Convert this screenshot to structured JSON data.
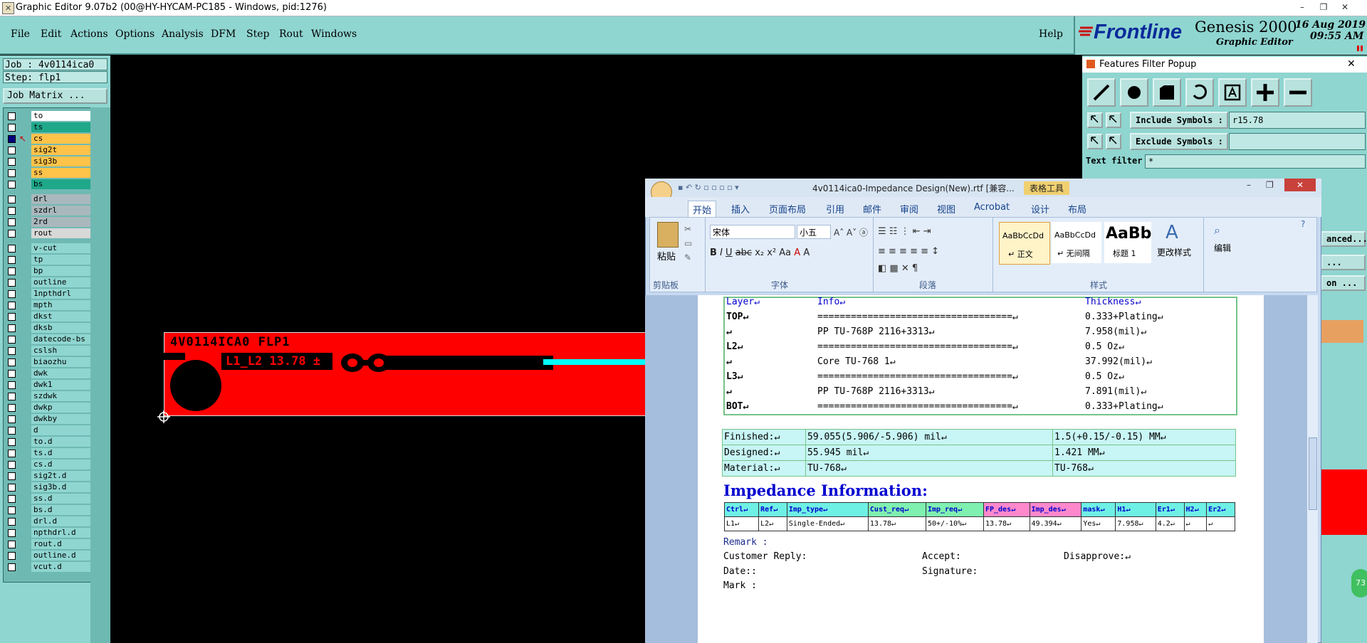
{
  "window": {
    "title": "Graphic Editor 9.07b2 (00@HY-HYCAM-PC185 - Windows, pid:1276)",
    "min": "–",
    "max": "❐",
    "close": "✕"
  },
  "menu": {
    "items": [
      "File",
      "Edit",
      "Actions",
      "Options",
      "Analysis",
      "DFM",
      "Step",
      "Rout",
      "Windows"
    ],
    "help": "Help"
  },
  "brand": {
    "logo": "Frontline",
    "product": "Genesis 2000",
    "subtitle": "Graphic Editor",
    "date": "16 Aug 2019",
    "time": "09:55 AM"
  },
  "left": {
    "job": "Job : 4v0114ica0",
    "step": "Step: flp1",
    "job_matrix": "Job Matrix ...",
    "layers": [
      {
        "name": "to",
        "color": "#ffffff",
        "on": false
      },
      {
        "name": "ts",
        "color": "#1fa88a",
        "on": false
      },
      {
        "name": "cs",
        "color": "#ffc34a",
        "on": true
      },
      {
        "name": "sig2t",
        "color": "#ffc34a",
        "on": false
      },
      {
        "name": "sig3b",
        "color": "#ffc34a",
        "on": false
      },
      {
        "name": "ss",
        "color": "#ffc34a",
        "on": false
      },
      {
        "name": "bs",
        "color": "#1fa88a",
        "on": false
      },
      {
        "name": "drl",
        "color": "#a9b8bd",
        "on": false
      },
      {
        "name": "szdrl",
        "color": "#a9b8bd",
        "on": false
      },
      {
        "name": "2rd",
        "color": "#a9b8bd",
        "on": false
      },
      {
        "name": "rout",
        "color": "#d8d8d8",
        "on": false
      },
      {
        "name": "v-cut",
        "color": "#8fd5d0",
        "on": false
      },
      {
        "name": "tp",
        "color": "#8fd5d0",
        "on": false
      },
      {
        "name": "bp",
        "color": "#8fd5d0",
        "on": false
      },
      {
        "name": "outline",
        "color": "#8fd5d0",
        "on": false
      },
      {
        "name": "1npthdrl",
        "color": "#8fd5d0",
        "on": false
      },
      {
        "name": "mpth",
        "color": "#8fd5d0",
        "on": false
      },
      {
        "name": "dkst",
        "color": "#8fd5d0",
        "on": false
      },
      {
        "name": "dksb",
        "color": "#8fd5d0",
        "on": false
      },
      {
        "name": "datecode-bs",
        "color": "#8fd5d0",
        "on": false
      },
      {
        "name": "cslsh",
        "color": "#8fd5d0",
        "on": false
      },
      {
        "name": "biaozhu",
        "color": "#8fd5d0",
        "on": false
      },
      {
        "name": "dwk",
        "color": "#8fd5d0",
        "on": false
      },
      {
        "name": "dwk1",
        "color": "#8fd5d0",
        "on": false
      },
      {
        "name": "szdwk",
        "color": "#8fd5d0",
        "on": false
      },
      {
        "name": "dwkp",
        "color": "#8fd5d0",
        "on": false
      },
      {
        "name": "dwkby",
        "color": "#8fd5d0",
        "on": false
      },
      {
        "name": "d",
        "color": "#8fd5d0",
        "on": false
      },
      {
        "name": "to.d",
        "color": "#8fd5d0",
        "on": false
      },
      {
        "name": "ts.d",
        "color": "#8fd5d0",
        "on": false
      },
      {
        "name": "cs.d",
        "color": "#8fd5d0",
        "on": false
      },
      {
        "name": "sig2t.d",
        "color": "#8fd5d0",
        "on": false
      },
      {
        "name": "sig3b.d",
        "color": "#8fd5d0",
        "on": false
      },
      {
        "name": "ss.d",
        "color": "#8fd5d0",
        "on": false
      },
      {
        "name": "bs.d",
        "color": "#8fd5d0",
        "on": false
      },
      {
        "name": "drl.d",
        "color": "#8fd5d0",
        "on": false
      },
      {
        "name": "npthdrl.d",
        "color": "#8fd5d0",
        "on": false
      },
      {
        "name": "rout.d",
        "color": "#8fd5d0",
        "on": false
      },
      {
        "name": "outline.d",
        "color": "#8fd5d0",
        "on": false
      },
      {
        "name": "vcut.d",
        "color": "#8fd5d0",
        "on": false
      }
    ]
  },
  "canvas": {
    "pcb_text1": "4V0114ICA0 FLP1",
    "pcb_text2": "L1_L2 13.78 ±"
  },
  "filter": {
    "title": "Features Filter Popup",
    "close": "✕",
    "include_label": "Include Symbols :",
    "include_value": "r15.78",
    "exclude_label": "Exclude Symbols :",
    "exclude_value": "",
    "text_filter_label": "Text filter",
    "text_filter_value": "*",
    "advanced": "anced...",
    "dots1": "...",
    "dots2": "on ..."
  },
  "word": {
    "title": "4v0114ica0-Impedance Design(New).rtf [兼容...",
    "context": "表格工具",
    "tabs": [
      "开始",
      "插入",
      "页面布局",
      "引用",
      "邮件",
      "审阅",
      "视图",
      "Acrobat",
      "设计",
      "布局"
    ],
    "ribbon": {
      "paste": "粘贴",
      "clipboard": "剪贴板",
      "font_name": "宋体",
      "font_size": "小五",
      "font_group": "字体",
      "para_group": "段落",
      "styles_group": "样式",
      "styles": [
        {
          "sample": "AaBbCcDd",
          "name": "↵ 正文"
        },
        {
          "sample": "AaBbCcDd",
          "name": "↵ 无间隔"
        },
        {
          "sample": "AaBb",
          "name": "标题 1"
        }
      ],
      "change_styles": "更改样式",
      "edit": "编辑"
    },
    "stack": {
      "headers": [
        "Layer↵",
        "Info↵",
        "Thickness↵"
      ],
      "rows": [
        [
          "TOP↵",
          "===================================↵",
          "0.333+Plating↵"
        ],
        [
          "↵",
          "PP     TU-768P    2116+3313↵",
          "7.958(mil)↵"
        ],
        [
          "L2↵",
          "===================================↵",
          "0.5 Oz↵"
        ],
        [
          "↵",
          "Core     TU-768    1↵",
          "37.992(mil)↵"
        ],
        [
          "L3↵",
          "===================================↵",
          "0.5 Oz↵"
        ],
        [
          "↵",
          "PP     TU-768P    2116+3313↵",
          "7.891(mil)↵"
        ],
        [
          "BOT↵",
          "===================================↵",
          "0.333+Plating↵"
        ]
      ]
    },
    "spec": [
      [
        "Finished:↵",
        "59.055(5.906/-5.906) mil↵",
        "1.5(+0.15/-0.15) MM↵"
      ],
      [
        "Designed:↵",
        "55.945 mil↵",
        "1.421 MM↵"
      ],
      [
        "Material:↵",
        "TU-768↵",
        "TU-768↵"
      ]
    ],
    "impedance_title": "Impedance Information:",
    "imp_headers": [
      "Ctrl↵",
      "Ref↵",
      "Imp_type↵",
      "Cust_req↵",
      "Imp_req↵",
      "FP_des↵",
      "Imp_des↵",
      "mask↵",
      "H1↵",
      "Er1↵",
      "H2↵",
      "Er2↵"
    ],
    "imp_row": [
      "L1↵",
      "L2↵",
      "Single-Ended↵",
      "13.78↵",
      "50+/-10%↵",
      "13.78↵",
      "49.394↵",
      "Yes↵",
      "7.958↵",
      "4.2↵",
      "↵",
      "↵"
    ],
    "remark": "Remark :",
    "customer_reply": "Customer Reply:",
    "accept": "Accept:",
    "disapprove": "Disapprove:↵",
    "date": "Date::",
    "signature": "Signature:",
    "mark": "Mark :"
  },
  "badge": "73"
}
